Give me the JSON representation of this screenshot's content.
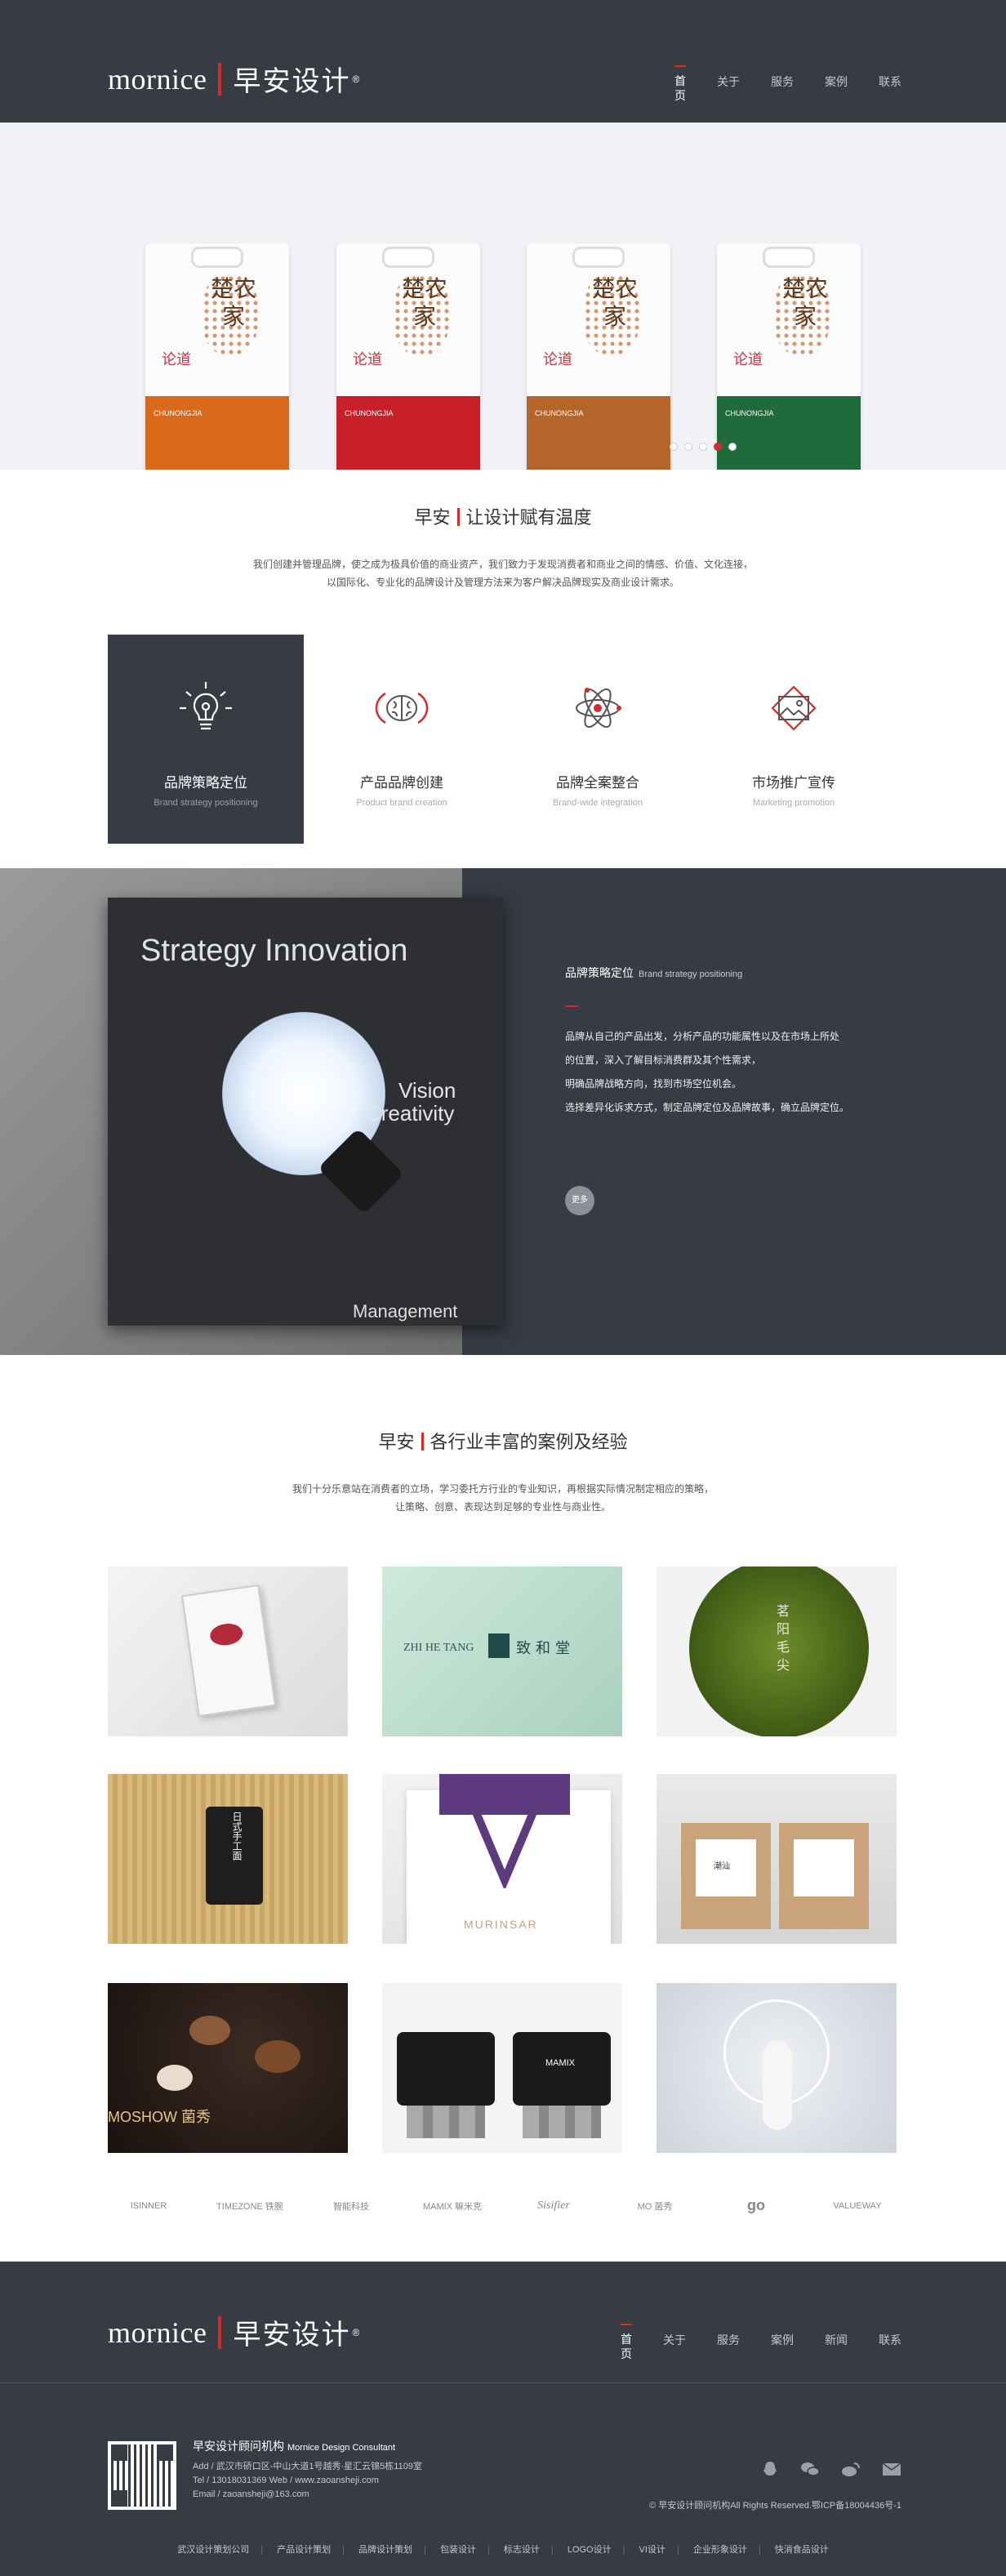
{
  "header": {
    "logo_en": "mornice",
    "logo_cn": "早安设计",
    "logo_reg": "®",
    "nav": [
      {
        "label": "首页"
      },
      {
        "label": "关于"
      },
      {
        "label": "服务"
      },
      {
        "label": "案例"
      },
      {
        "label": "联系"
      }
    ]
  },
  "banner": {
    "bags": [
      {
        "chars": "楚农家",
        "band_color": "#d96a1c",
        "band_text": "CHUNONGJIA"
      },
      {
        "chars": "楚农家",
        "band_color": "#c8202a",
        "band_text": "CHUNONGJIA"
      },
      {
        "chars": "楚农家",
        "band_color": "#b5652a",
        "band_text": "CHUNONGJIA"
      },
      {
        "chars": "楚农家",
        "band_color": "#1f6b3c",
        "band_text": "CHUNONGJIA"
      }
    ],
    "bag_small": "论道",
    "slide_count": 5,
    "active_slide": 3
  },
  "intro": {
    "title_a": "早安",
    "title_b": "让设计赋有温度",
    "line1": "我们创建并管理品牌，使之成为极具价值的商业资产，我们致力于发现消费者和商业之间的情感、价值、文化连接，",
    "line2": "以国际化、专业化的品牌设计及管理方法来为客户解决品牌现实及商业设计需求。"
  },
  "services": [
    {
      "title": "品牌策略定位",
      "sub": "Brand strategy positioning",
      "icon": "lightbulb-icon"
    },
    {
      "title": "产品品牌创建",
      "sub": "Product brand creation",
      "icon": "brain-icon"
    },
    {
      "title": "品牌全案整合",
      "sub": "Brand-wide integration",
      "icon": "atom-icon"
    },
    {
      "title": "市场推广宣传",
      "sub": "Marketing promotion",
      "icon": "picture-icon"
    }
  ],
  "strategy": {
    "board_heading": "Strategy Innovation",
    "board_vision": "Vision",
    "board_creativity": "Creativity",
    "board_mgmt": "Management",
    "title": "品牌策略定位",
    "title_en": "Brand strategy positioning",
    "p1": "品牌从自己的产品出发，分析产品的功能属性以及在市场上所处",
    "p2": "的位置，深入了解目标消费群及其个性需求，",
    "p3": "明确品牌战略方向，找到市场空位机会。",
    "p4": "选择差异化诉求方式，制定品牌定位及品牌故事，确立品牌定位。",
    "more": "更多"
  },
  "cases": {
    "title_a": "早安",
    "title_b": "各行业丰富的案例及经验",
    "line1": "我们十分乐意站在消费者的立场，学习委托方行业的专业知识，再根据实际情况制定相应的策略，",
    "line2": "让策略、创意、表现达到足够的专业性与商业性。",
    "items": [
      {
        "label": ""
      },
      {
        "label": "ZHI HE TANG",
        "label2": "致和堂"
      },
      {
        "label": "茗阳毛尖"
      },
      {
        "label": "日式手工面"
      },
      {
        "label": "MURINSAR"
      },
      {
        "label": "潮汕"
      },
      {
        "label": "MOSHOW 菌秀"
      },
      {
        "label": "MAMIX"
      },
      {
        "label": ""
      }
    ]
  },
  "brands": [
    "ISINNER",
    "TIMEZONE 铁腕",
    "智能科技",
    "MAMIX 嘛米克",
    "Sisifier",
    "MO 菌秀",
    "go",
    "VALUEWAY"
  ],
  "footer": {
    "logo_en": "mornice",
    "logo_cn": "早安设计",
    "nav": [
      {
        "label": "首页"
      },
      {
        "label": "关于"
      },
      {
        "label": "服务"
      },
      {
        "label": "案例"
      },
      {
        "label": "新闻"
      },
      {
        "label": "联系"
      }
    ],
    "company": "早安设计顾问机构",
    "company_en": "Mornice Design Consultant",
    "addr": "Add / 武汉市硚口区-中山大道1号越秀·星汇云锦5栋1109室",
    "tel": "Tel / 13018031369    Web / www.zaoansheji.com",
    "email": "Email / zaoansheji@163.com",
    "copyright": "© 早安设计顾问机构All Rights Reserved.鄂ICP备18004436号-1",
    "links": [
      "武汉设计策划公司",
      "产品设计策划",
      "品牌设计策划",
      "包装设计",
      "标志设计",
      "LOGO设计",
      "VI设计",
      "企业形象设计",
      "快消食品设计"
    ]
  }
}
